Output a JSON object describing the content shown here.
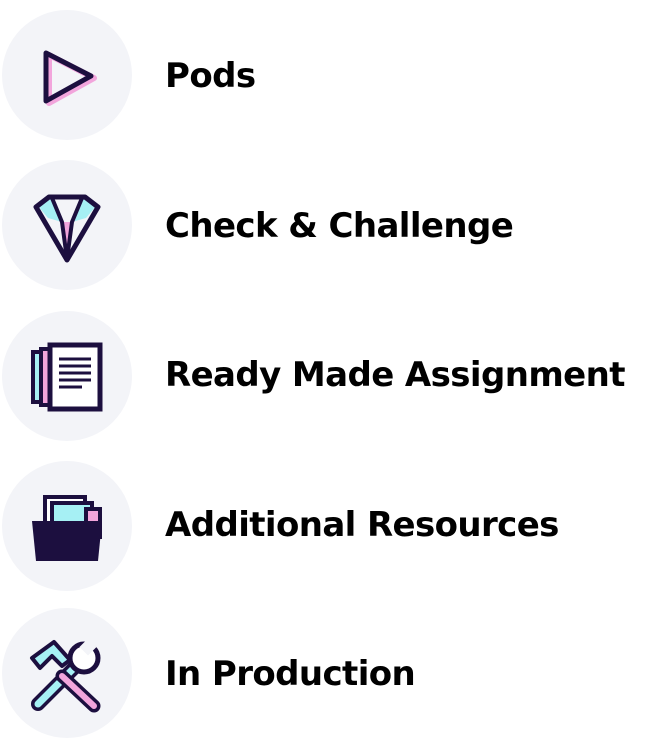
{
  "legend": {
    "items": [
      {
        "label": "Pods",
        "icon": "play-icon"
      },
      {
        "label": "Check & Challenge",
        "icon": "diamond-icon"
      },
      {
        "label": "Ready Made Assignment",
        "icon": "document-icon"
      },
      {
        "label": "Additional Resources",
        "icon": "folder-icon"
      },
      {
        "label": "In Production",
        "icon": "tools-icon"
      }
    ]
  },
  "colors": {
    "circle_background": "#f3f4f8",
    "icon_outline": "#1c0f3f",
    "icon_cyan": "#a6f0f4",
    "icon_pink": "#f2a5dc",
    "text": "#000000"
  }
}
